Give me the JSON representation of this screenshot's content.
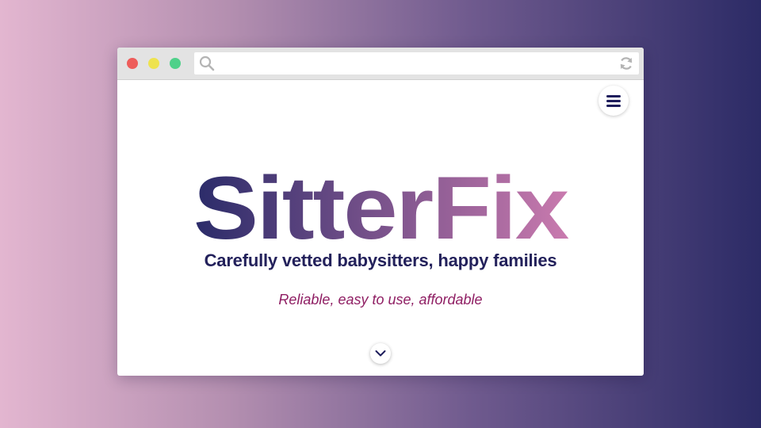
{
  "brand": {
    "name": "SitterFix",
    "gradient_start": "#2a2b69",
    "gradient_end": "#c97aae"
  },
  "hero": {
    "tagline": "Carefully vetted babysitters, happy families",
    "subtagline": "Reliable, easy to use, affordable"
  },
  "browser": {
    "url": "",
    "icons": {
      "search": "search-icon",
      "reload": "reload-icon",
      "menu": "hamburger-menu-icon",
      "scroll": "chevron-down-icon"
    },
    "controls": {
      "close_color": "#ee5d5b",
      "minimize_color": "#eee34f",
      "maximize_color": "#4fd18a"
    }
  },
  "colors": {
    "tagline": "#23215b",
    "subtagline": "#8f1e63"
  }
}
